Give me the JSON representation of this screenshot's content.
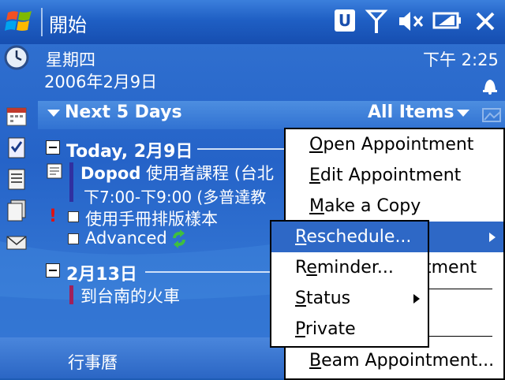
{
  "titlebar": {
    "title": "開始"
  },
  "today_panel": {
    "weekday": "星期四",
    "date": "2006年2月9日",
    "time": "下午 2:25"
  },
  "calendar": {
    "range_label": "Next 5 Days",
    "filter_label": "All Items",
    "day1": {
      "label": "Today, 2月9日"
    },
    "appt1": {
      "title_bold": "Dopod",
      "title_rest": " 使用者課程 (台北",
      "time": "下7:00-下9:00 (多普達教"
    },
    "task1": "使用手冊排版樣本",
    "task2": "Advanced",
    "day2": {
      "label": "2月13日"
    },
    "appt2": {
      "title": "到台南的火車"
    }
  },
  "bottombar": {
    "left_softkey": "行事曆"
  },
  "context_menu": {
    "items": [
      {
        "accel": "O",
        "rest": "pen Appointment"
      },
      {
        "accel": "E",
        "rest": "dit Appointment"
      },
      {
        "accel": "M",
        "rest": "ake a Copy"
      },
      {
        "accel": "",
        "rest": ""
      },
      {
        "accel": "",
        "rest": "tment"
      },
      {
        "accel": "",
        "rest": ""
      },
      {
        "accel": "",
        "rest": ""
      },
      {
        "accel": "B",
        "rest": "eam Appointment..."
      }
    ]
  },
  "sub_menu": {
    "items": [
      {
        "accel": "R",
        "rest": "eschedule..."
      },
      {
        "prefix": "R",
        "accel": "e",
        "rest": "minder..."
      },
      {
        "accel": "S",
        "rest": "tatus"
      },
      {
        "accel": "P",
        "rest": "rivate"
      }
    ]
  }
}
